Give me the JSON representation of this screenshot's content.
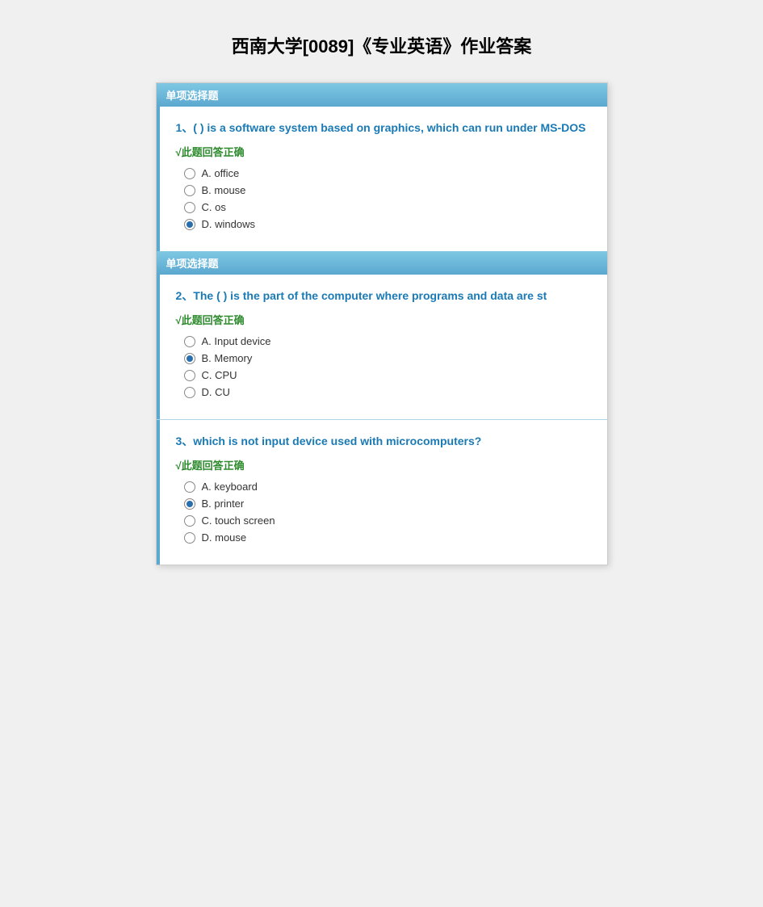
{
  "page": {
    "title": "西南大学[0089]《专业英语》作业答案"
  },
  "sections": [
    {
      "id": "section1",
      "header": "单项选择题",
      "questions": [
        {
          "id": "q1",
          "number": "1、",
          "text": "( ) is a software system based on graphics, which can run under MS-DOS",
          "correct_label": "√此题回答正确",
          "options": [
            {
              "id": "A",
              "label": "A. office",
              "selected": false
            },
            {
              "id": "B",
              "label": "B. mouse",
              "selected": false
            },
            {
              "id": "C",
              "label": "C. os",
              "selected": false
            },
            {
              "id": "D",
              "label": "D. windows",
              "selected": true
            }
          ]
        }
      ]
    },
    {
      "id": "section2",
      "header": "单项选择题",
      "questions": [
        {
          "id": "q2",
          "number": "2、",
          "text": "The ( ) is the part of the computer where programs and data are st",
          "correct_label": "√此题回答正确",
          "options": [
            {
              "id": "A",
              "label": "A. Input device",
              "selected": false
            },
            {
              "id": "B",
              "label": "B. Memory",
              "selected": true
            },
            {
              "id": "C",
              "label": "C. CPU",
              "selected": false
            },
            {
              "id": "D",
              "label": "D. CU",
              "selected": false
            }
          ]
        },
        {
          "id": "q3",
          "number": "3、",
          "text": "which is not input device used with microcomputers?",
          "correct_label": "√此题回答正确",
          "options": [
            {
              "id": "A",
              "label": "A. keyboard",
              "selected": false
            },
            {
              "id": "B",
              "label": "B. printer",
              "selected": true
            },
            {
              "id": "C",
              "label": "C. touch screen",
              "selected": false
            },
            {
              "id": "D",
              "label": "D. mouse",
              "selected": false
            }
          ]
        }
      ]
    }
  ]
}
